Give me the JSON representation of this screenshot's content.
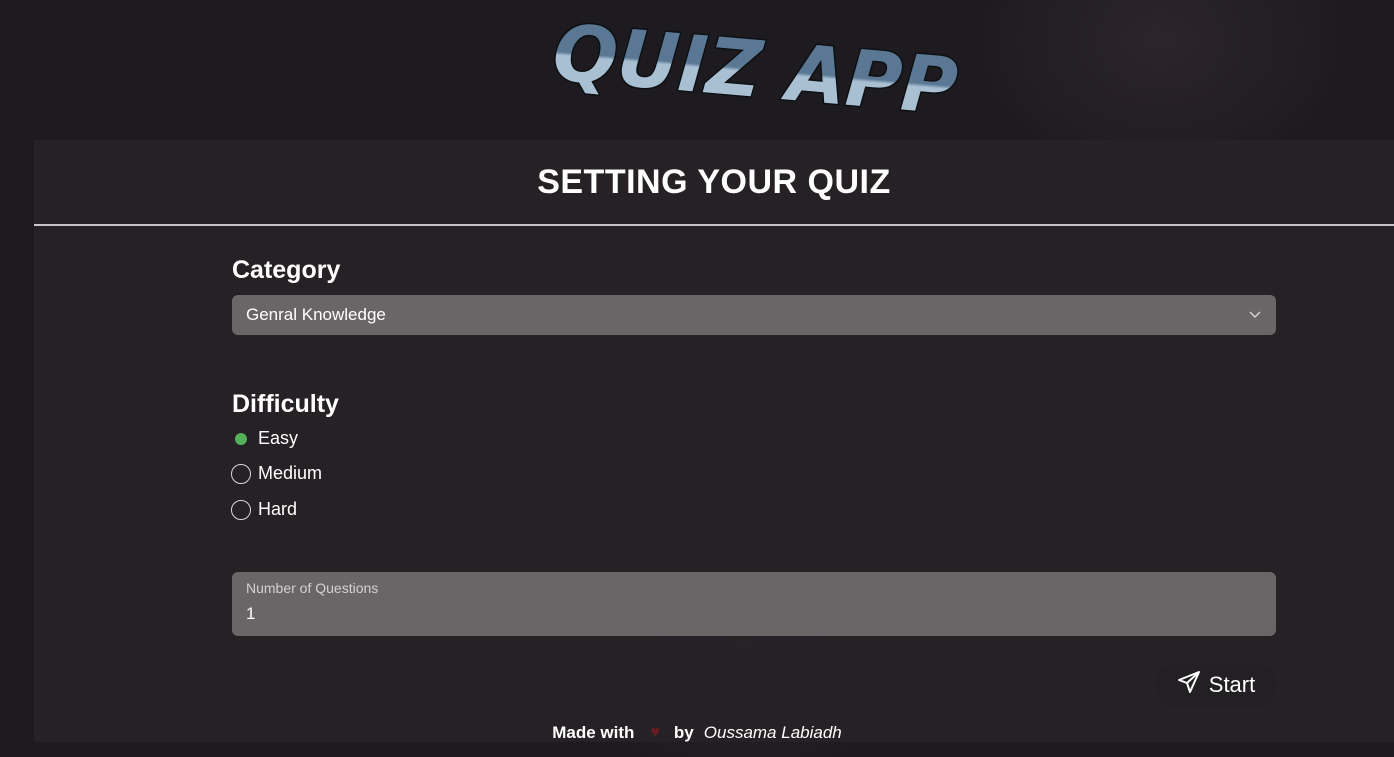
{
  "app": {
    "title": "QUIZ APP"
  },
  "card": {
    "title": "SETTING YOUR QUIZ"
  },
  "category": {
    "label": "Category",
    "selected": "Genral Knowledge"
  },
  "difficulty": {
    "label": "Difficulty",
    "options": [
      {
        "label": "Easy",
        "checked": true
      },
      {
        "label": "Medium",
        "checked": false
      },
      {
        "label": "Hard",
        "checked": false
      }
    ]
  },
  "questions": {
    "label": "Number of Questions",
    "value": "1"
  },
  "start": {
    "label": "Start",
    "icon": "send-icon"
  },
  "footer": {
    "made_with": "Made with",
    "heart_icon": "heart-icon",
    "by": "by",
    "author": "Oussama Labiadh"
  },
  "colors": {
    "background": "#1e1b20",
    "field": "#6a6668",
    "radio_checked": "#55b05a",
    "logo_fill": "#6d8ca8"
  }
}
